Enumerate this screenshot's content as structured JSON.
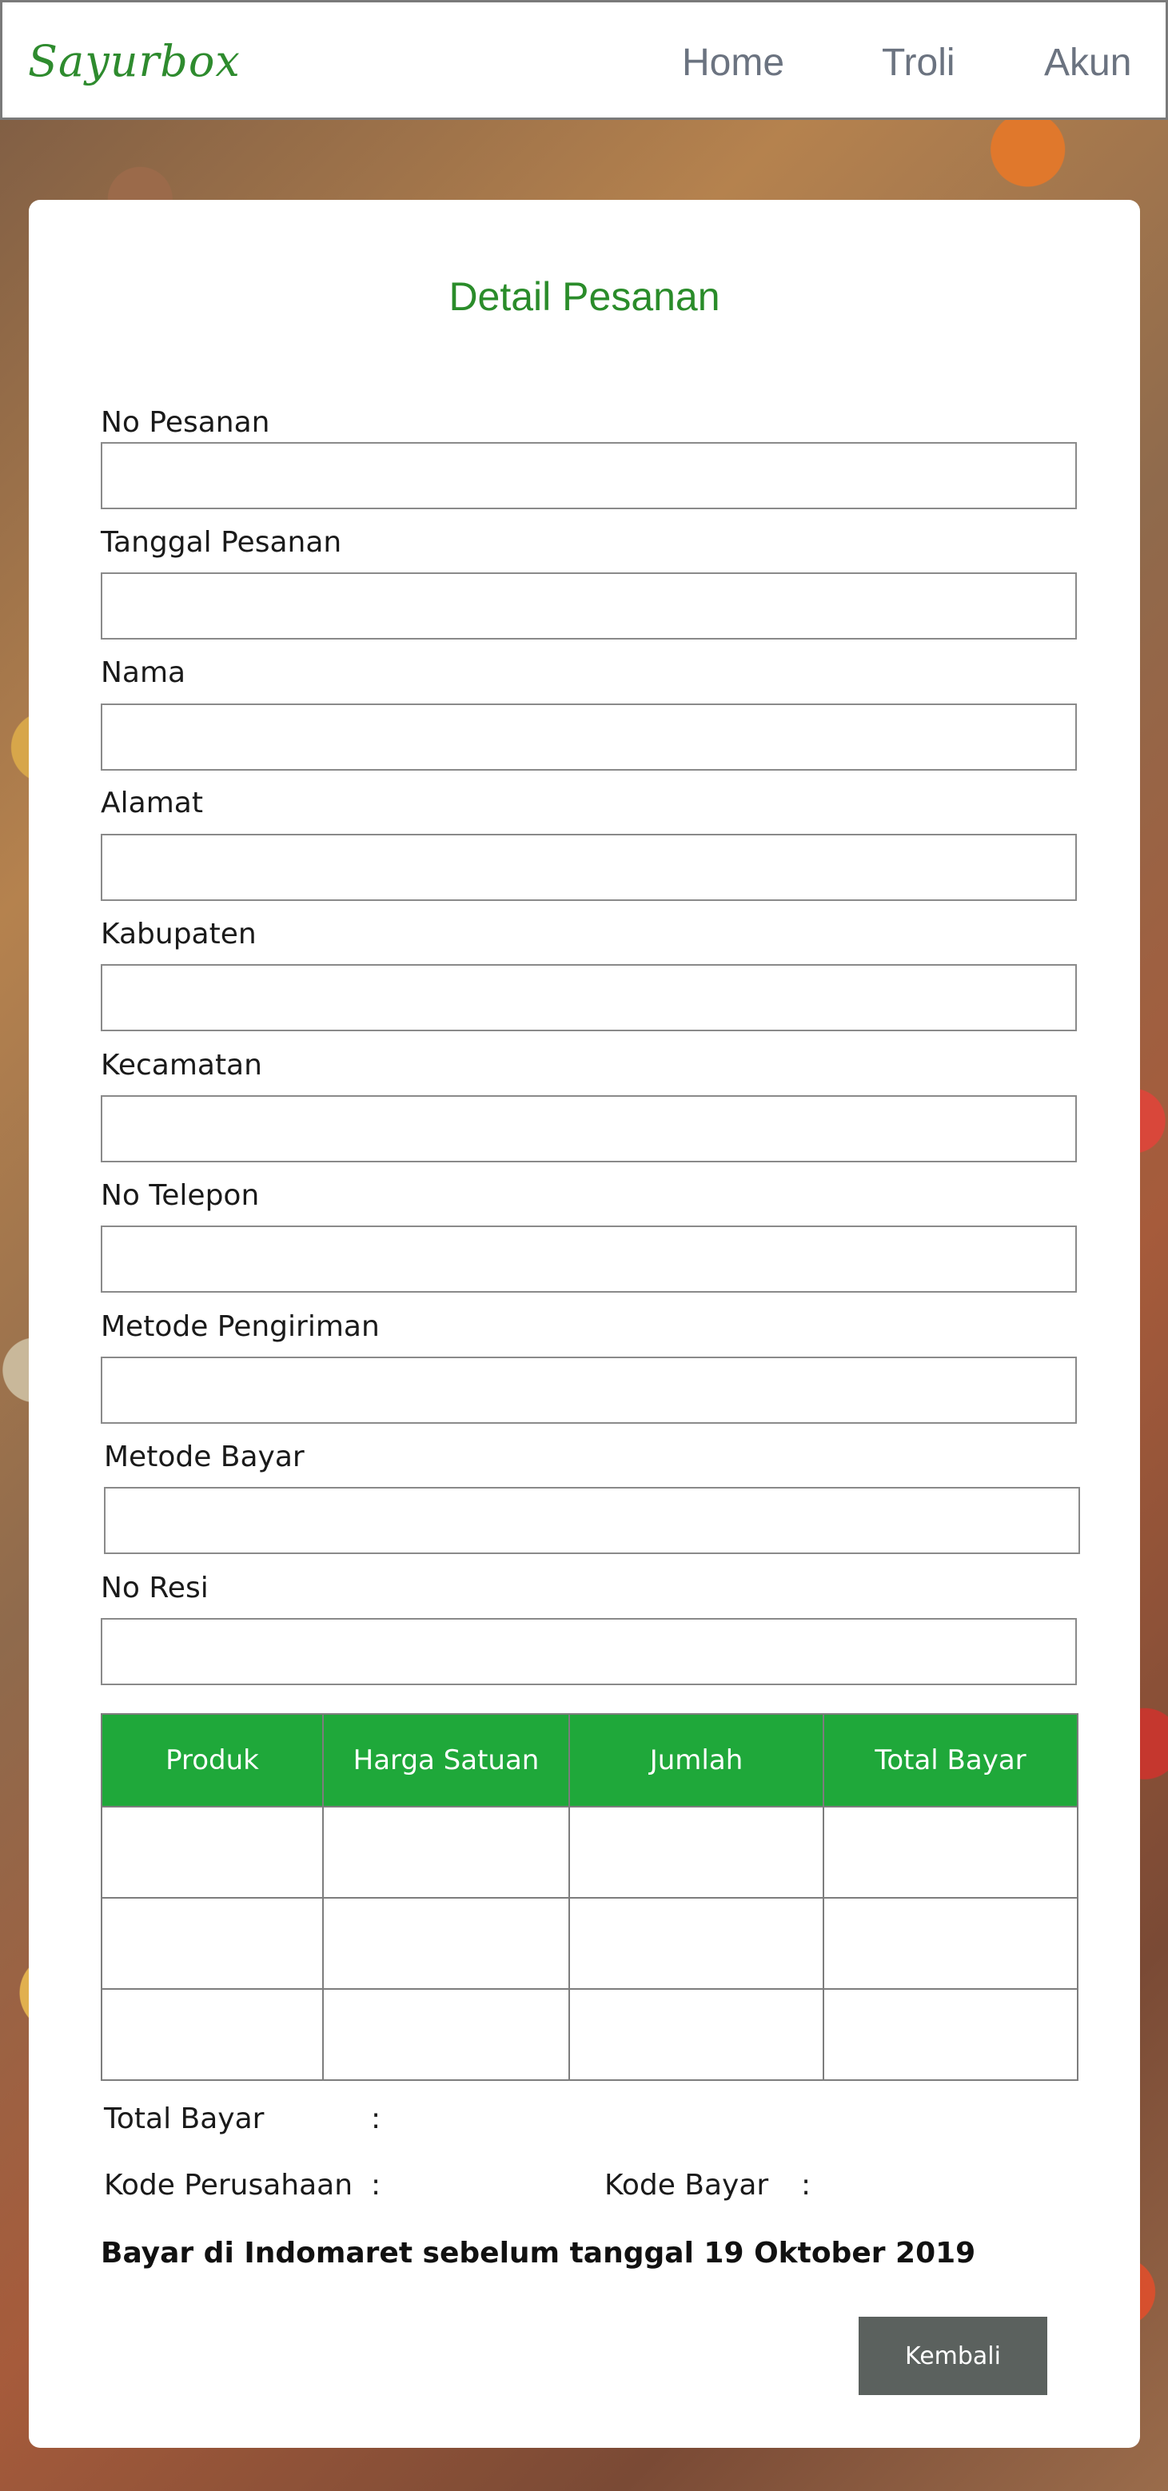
{
  "navbar": {
    "brand": "Sayurbox",
    "links": [
      "Home",
      "Troli",
      "Akun"
    ]
  },
  "page": {
    "title": "Detail Pesanan"
  },
  "form": {
    "fields": [
      {
        "label": "No Pesanan",
        "value": ""
      },
      {
        "label": "Tanggal Pesanan",
        "value": ""
      },
      {
        "label": "Nama",
        "value": ""
      },
      {
        "label": "Alamat",
        "value": ""
      },
      {
        "label": "Kabupaten",
        "value": ""
      },
      {
        "label": "Kecamatan",
        "value": ""
      },
      {
        "label": "No Telepon",
        "value": ""
      },
      {
        "label": "Metode Pengiriman",
        "value": ""
      },
      {
        "label": "Metode Bayar",
        "value": ""
      },
      {
        "label": "No Resi",
        "value": ""
      }
    ]
  },
  "table": {
    "headers": [
      "Produk",
      "Harga Satuan",
      "Jumlah",
      "Total Bayar"
    ],
    "rows": [
      [
        "",
        "",
        "",
        ""
      ],
      [
        "",
        "",
        "",
        ""
      ],
      [
        "",
        "",
        "",
        ""
      ]
    ]
  },
  "summary": {
    "total_bayar_label": "Total Bayar",
    "kode_perusahaan_label": "Kode Perusahaan",
    "kode_bayar_label": "Kode Bayar",
    "colon": ":"
  },
  "notice": "Bayar di Indomaret sebelum tanggal 19 Oktober 2019",
  "buttons": {
    "back": "Kembali"
  },
  "colors": {
    "brand": "#2e8b2e",
    "title": "#2a8c2a",
    "table_header": "#1fa83a",
    "button": "#5b615e"
  }
}
